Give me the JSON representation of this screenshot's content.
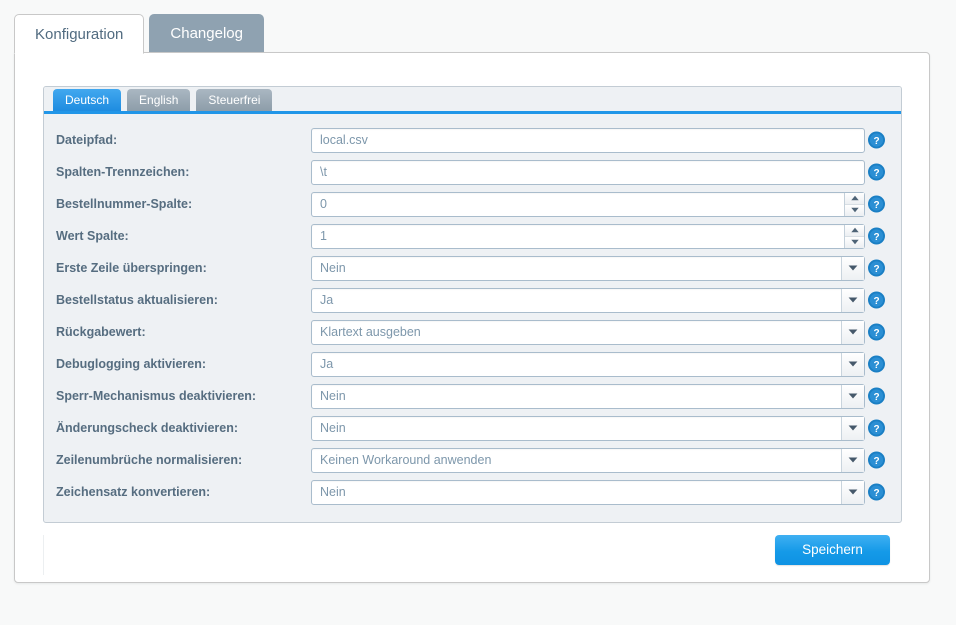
{
  "outer_tabs": [
    {
      "label": "Konfiguration",
      "active": true
    },
    {
      "label": "Changelog",
      "active": false
    }
  ],
  "language_tabs": [
    {
      "label": "Deutsch",
      "active": true
    },
    {
      "label": "English",
      "active": false
    },
    {
      "label": "Steuerfrei",
      "active": false
    }
  ],
  "form": {
    "rows": [
      {
        "label": "Dateipfad:",
        "value": "local.csv",
        "type": "text"
      },
      {
        "label": "Spalten-Trennzeichen:",
        "value": "\\t",
        "type": "text"
      },
      {
        "label": "Bestellnummer-Spalte:",
        "value": "0",
        "type": "spinner"
      },
      {
        "label": "Wert Spalte:",
        "value": "1",
        "type": "spinner"
      },
      {
        "label": "Erste Zeile überspringen:",
        "value": "Nein",
        "type": "select"
      },
      {
        "label": "Bestellstatus aktualisieren:",
        "value": "Ja",
        "type": "select"
      },
      {
        "label": "Rückgabewert:",
        "value": "Klartext ausgeben",
        "type": "select"
      },
      {
        "label": "Debuglogging aktivieren:",
        "value": "Ja",
        "type": "select"
      },
      {
        "label": "Sperr-Mechanismus deaktivieren:",
        "value": "Nein",
        "type": "select"
      },
      {
        "label": "Änderungscheck deaktivieren:",
        "value": "Nein",
        "type": "select"
      },
      {
        "label": "Zeilenumbrüche normalisieren:",
        "value": "Keinen Workaround anwenden",
        "type": "select"
      },
      {
        "label": "Zeichensatz konvertieren:",
        "value": "Nein",
        "type": "select"
      }
    ],
    "help_icon": "help-question-icon"
  },
  "footer": {
    "save_label": "Speichern"
  },
  "colors": {
    "accent_blue": "#1e8ce0",
    "tab_inactive": "#8fa2b1",
    "label_text": "#566d80",
    "value_text": "#7d97ab",
    "panel_bg": "#eef1f4",
    "page_bg": "#f8f9f9",
    "help_icon": "#1a7fc4"
  }
}
